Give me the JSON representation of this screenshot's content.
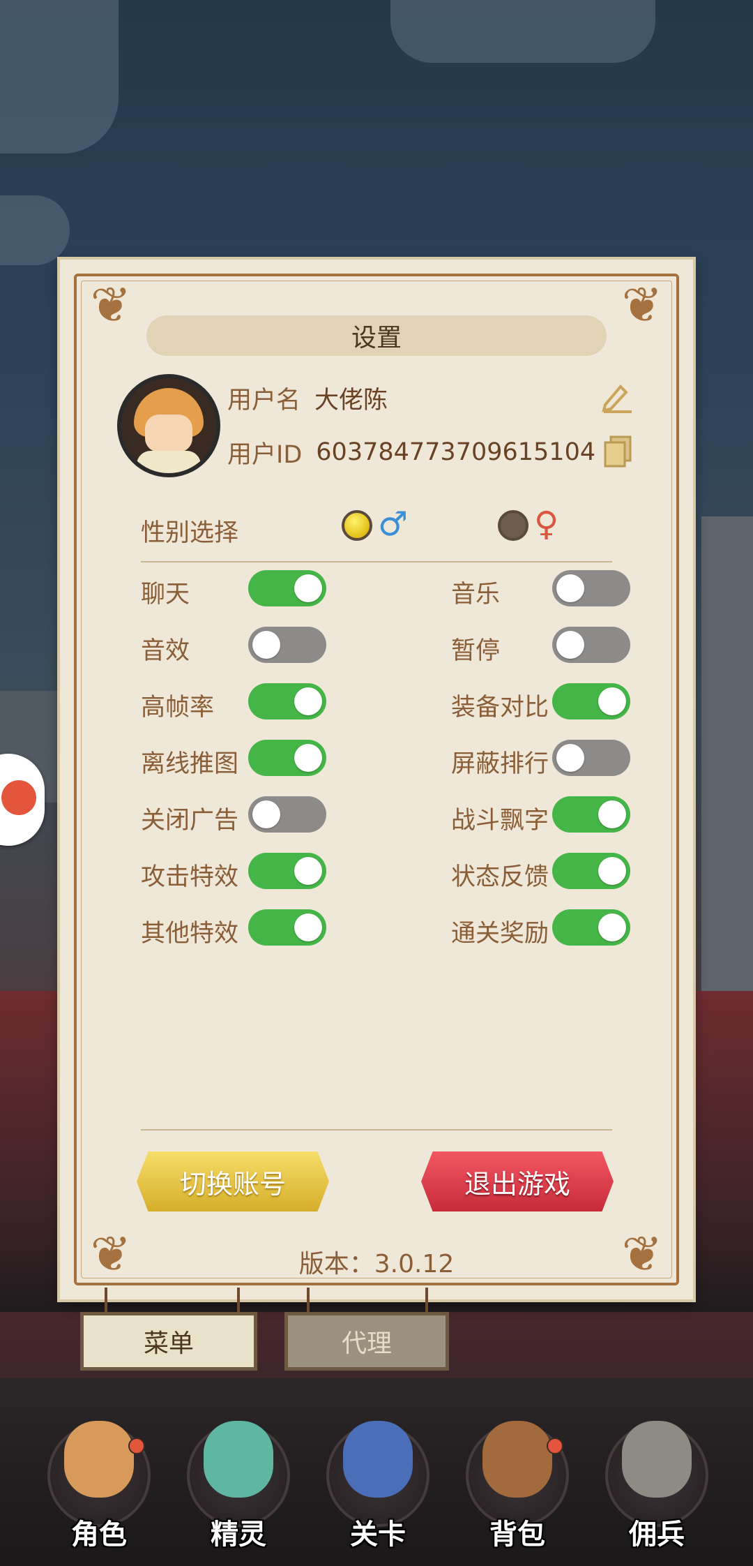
{
  "panel": {
    "title": "设置",
    "username_label": "用户名",
    "username_value": "大佬陈",
    "userid_label": "用户ID",
    "userid_value": "603784773709615104",
    "gender_label": "性别选择",
    "male_symbol": "♂",
    "female_symbol": "♀",
    "gender_selected": "male"
  },
  "toggles": [
    {
      "label": "聊天",
      "on": true
    },
    {
      "label": "音乐",
      "on": false
    },
    {
      "label": "音效",
      "on": false
    },
    {
      "label": "暂停",
      "on": false
    },
    {
      "label": "高帧率",
      "on": true
    },
    {
      "label": "装备对比",
      "on": true
    },
    {
      "label": "离线推图",
      "on": true
    },
    {
      "label": "屏蔽排行",
      "on": false
    },
    {
      "label": "关闭广告",
      "on": false
    },
    {
      "label": "战斗飘字",
      "on": true
    },
    {
      "label": "攻击特效",
      "on": true
    },
    {
      "label": "状态反馈",
      "on": true
    },
    {
      "label": "其他特效",
      "on": true
    },
    {
      "label": "通关奖励",
      "on": true
    }
  ],
  "buttons": {
    "switch_account": "切换账号",
    "quit_game": "退出游戏"
  },
  "version": "版本：3.0.12",
  "tabs": {
    "menu": "菜单",
    "agent": "代理"
  },
  "nav": [
    {
      "label": "角色",
      "badge": true
    },
    {
      "label": "精灵",
      "badge": false
    },
    {
      "label": "关卡",
      "badge": false
    },
    {
      "label": "背包",
      "badge": true
    },
    {
      "label": "佣兵",
      "badge": false
    }
  ],
  "colors": {
    "toggle_on": "#45b547",
    "toggle_off": "#8d8b89",
    "quit_button": "#e03a47",
    "switch_button": "#eac44a",
    "male": "#3a8fd6",
    "female": "#d9573f"
  }
}
